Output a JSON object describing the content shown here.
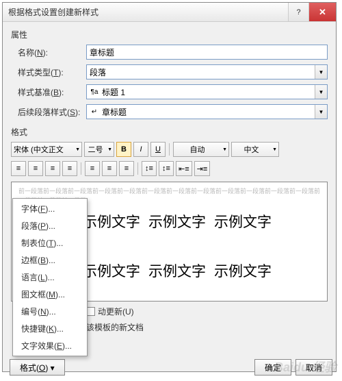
{
  "window": {
    "title": "根据格式设置创建新样式"
  },
  "section": {
    "properties": "属性",
    "format": "格式"
  },
  "labels": {
    "name": "名称(",
    "name_u": "N",
    "name_end": "):",
    "styleType": "样式类型(",
    "styleType_u": "T",
    "styleType_end": "):",
    "basedOn": "样式基准(",
    "basedOn_u": "B",
    "basedOn_end": "):",
    "following": "后续段落样式(",
    "following_u": "S",
    "following_end": "):"
  },
  "values": {
    "name": "章标题",
    "styleType": "段落",
    "basedOn": "标题 1",
    "following": "章标题"
  },
  "fmt": {
    "font": "宋体 (中文正文",
    "size": "二号",
    "auto": "自动",
    "lang": "中文"
  },
  "preview": {
    "ghost": "前一段落前一段落前一段落前一段落前一段落前一段落前一段落前一段落前一段落前一段落前一段落前一段落前一段落前一段落前一段落",
    "sample": "示例文字"
  },
  "checks": {
    "autoUpdate": "动更新(U)",
    "newDoc": "该模板的新文档"
  },
  "buttons": {
    "ok": "确定",
    "cancel": "取消",
    "format": "格式(",
    "format_u": "O",
    "format_end": ") ▾"
  },
  "menu": {
    "font": "字体(",
    "font_u": "F",
    "font_end": ")...",
    "para": "段落(",
    "para_u": "P",
    "para_end": ")...",
    "tab": "制表位(",
    "tab_u": "T",
    "tab_end": ")...",
    "border": "边框(",
    "border_u": "B",
    "border_end": ")...",
    "lang": "语言(",
    "lang_u": "L",
    "lang_end": ")...",
    "frame": "图文框(",
    "frame_u": "M",
    "frame_end": ")...",
    "num": "编号(",
    "num_u": "N",
    "num_end": ")...",
    "key": "快捷键(",
    "key_u": "K",
    "key_end": ")...",
    "fx": "文字效果(",
    "fx_u": "E",
    "fx_end": ")..."
  },
  "watermark": "Baidu 经验"
}
